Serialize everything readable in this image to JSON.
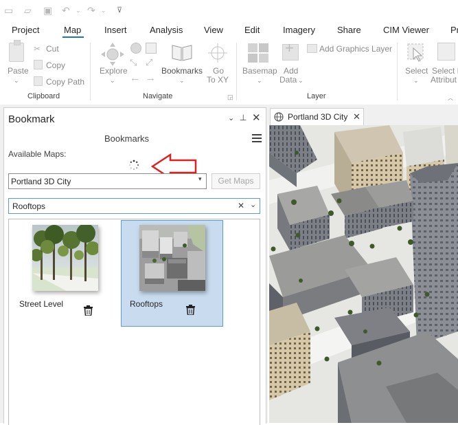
{
  "ribbon_tabs": [
    "Project",
    "Map",
    "Insert",
    "Analysis",
    "View",
    "Edit",
    "Imagery",
    "Share",
    "CIM Viewer",
    "Pr"
  ],
  "active_tab": "Map",
  "clipboard": {
    "paste": "Paste",
    "cut": "Cut",
    "copy": "Copy",
    "copy_path": "Copy Path",
    "group": "Clipboard"
  },
  "navigate": {
    "explore": "Explore",
    "bookmarks": "Bookmarks",
    "goto_line1": "Go",
    "goto_line2": "To XY",
    "group": "Navigate"
  },
  "layer": {
    "basemap": "Basemap",
    "add_data_line1": "Add",
    "add_data_line2": "Data",
    "add_graphics_layer": "Add Graphics Layer",
    "group": "Layer"
  },
  "selection": {
    "select": "Select",
    "select_by_line1": "Select B",
    "select_by_line2": "Attribut"
  },
  "pane": {
    "title": "Bookmark",
    "header": "Bookmarks",
    "available_maps_label": "Available Maps:",
    "map_value": "Portland 3D City",
    "get_maps": "Get Maps",
    "filter_value": "Rooftops"
  },
  "bookmarks": [
    {
      "label": "Street Level",
      "selected": false
    },
    {
      "label": "Rooftops",
      "selected": true
    }
  ],
  "map_tab": {
    "title": "Portland 3D City"
  },
  "colors": {
    "accent": "#1f6fc5",
    "selected_bg": "#c9dcef",
    "selected_border": "#5b9bd5",
    "annotation_arrow": "#e02020"
  }
}
